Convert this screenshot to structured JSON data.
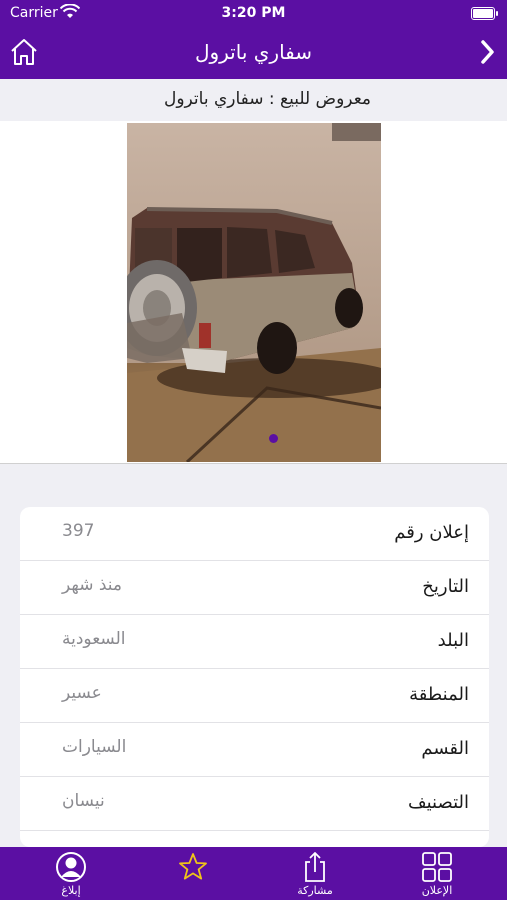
{
  "status_bar": {
    "carrier": "Carrier",
    "time": "3:20 PM"
  },
  "navbar": {
    "title": "سفاري باترول",
    "home_icon": "home-icon",
    "back_icon": "chevron-right-icon"
  },
  "subtitle": "معروض للبيع : سفاري باترول",
  "gallery": {
    "page_count": 1,
    "current_page": 1,
    "image_description": "photo of a car (Safari Patrol) parked at night"
  },
  "details": [
    {
      "label": "إعلان رقم",
      "value": "397"
    },
    {
      "label": "التاريخ",
      "value": "منذ شهر"
    },
    {
      "label": "البلد",
      "value": "السعودية"
    },
    {
      "label": "المنطقة",
      "value": "عسير"
    },
    {
      "label": "القسم",
      "value": "السيارات"
    },
    {
      "label": "التصنيف",
      "value": "نيسان"
    }
  ],
  "tabbar": [
    {
      "label": "إبلاغ",
      "icon": "report-user-icon"
    },
    {
      "label": "",
      "icon": "star-icon"
    },
    {
      "label": "مشاركة",
      "icon": "share-icon"
    },
    {
      "label": "الإعلان",
      "icon": "grid-icon"
    }
  ],
  "colors": {
    "brand": "#5b0fa3",
    "background": "#efeff4"
  }
}
